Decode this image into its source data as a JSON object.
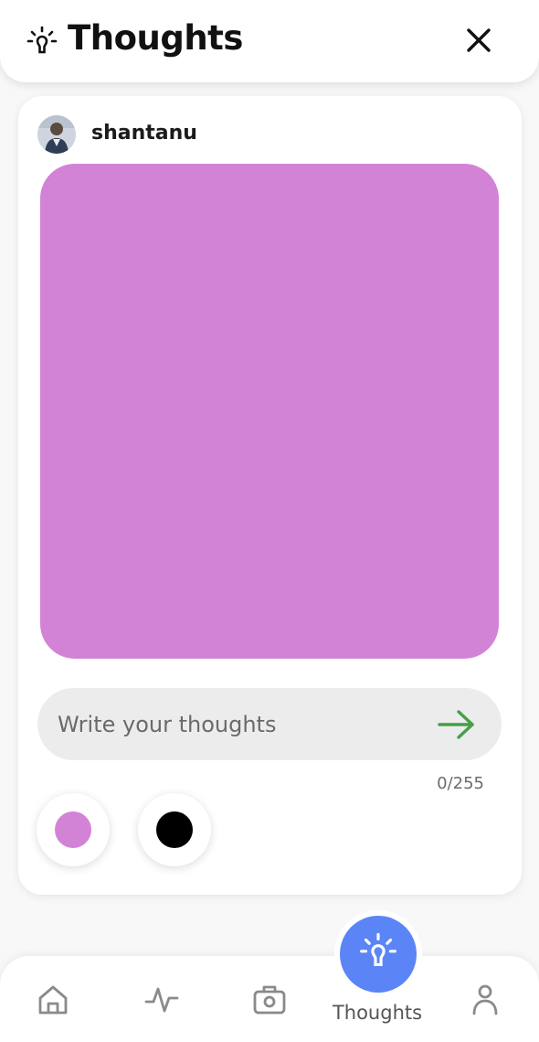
{
  "header": {
    "title": "Thoughts",
    "icon": "lightbulb-icon",
    "close_icon": "close-icon"
  },
  "post": {
    "username": "shantanu",
    "avatar_icon": "avatar",
    "canvas_color": "#D283D6",
    "input": {
      "placeholder": "Write your thoughts",
      "value": ""
    },
    "send_icon": "arrow-right-icon",
    "send_color": "#43A047",
    "char_counter": "0/255",
    "color_options": [
      {
        "name": "pink",
        "color": "#D283D6"
      },
      {
        "name": "black",
        "color": "#000000"
      }
    ]
  },
  "nav": {
    "items": [
      {
        "icon": "home-icon"
      },
      {
        "icon": "activity-icon"
      },
      {
        "icon": "camera-icon"
      },
      {
        "icon": "lightbulb-icon",
        "label": "Thoughts",
        "active": true,
        "color": "#5B85F6"
      },
      {
        "icon": "profile-icon"
      }
    ]
  }
}
